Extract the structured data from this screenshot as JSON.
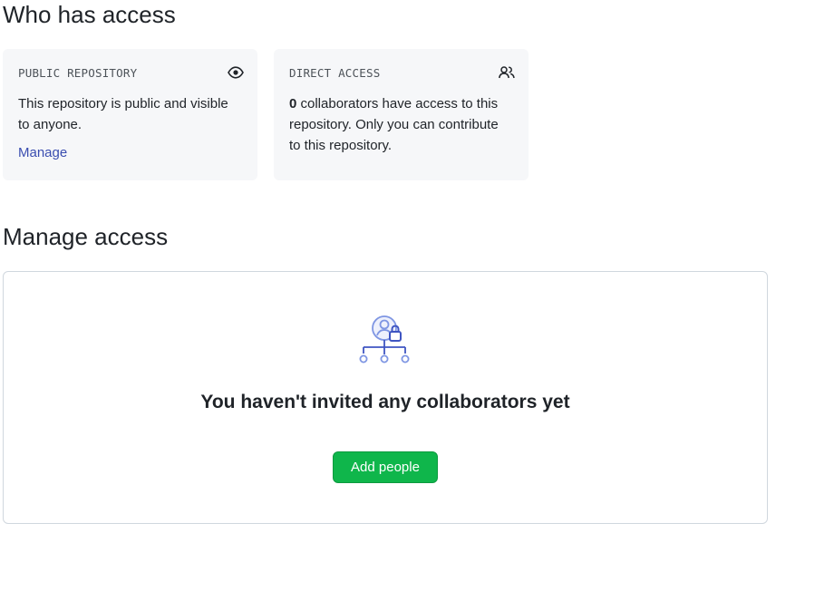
{
  "who_has_access": {
    "heading": "Who has access",
    "public_card": {
      "title": "PUBLIC REPOSITORY",
      "icon": "eye-icon",
      "body": "This repository is public and visible to anyone.",
      "link_label": "Manage"
    },
    "direct_card": {
      "title": "DIRECT ACCESS",
      "icon": "people-icon",
      "count": "0",
      "body_rest": " collaborators have access to this repository. Only you can contribute to this repository."
    }
  },
  "manage_access": {
    "heading": "Manage access",
    "empty_icon": "collaborators-lock-icon",
    "empty_title": "You haven't invited any collaborators yet",
    "add_button_label": "Add people"
  },
  "colors": {
    "link": "#3a4db0",
    "card_bg": "#f6f7f9",
    "button_bg": "#0fb64b",
    "illustration": "#7f96e3"
  }
}
